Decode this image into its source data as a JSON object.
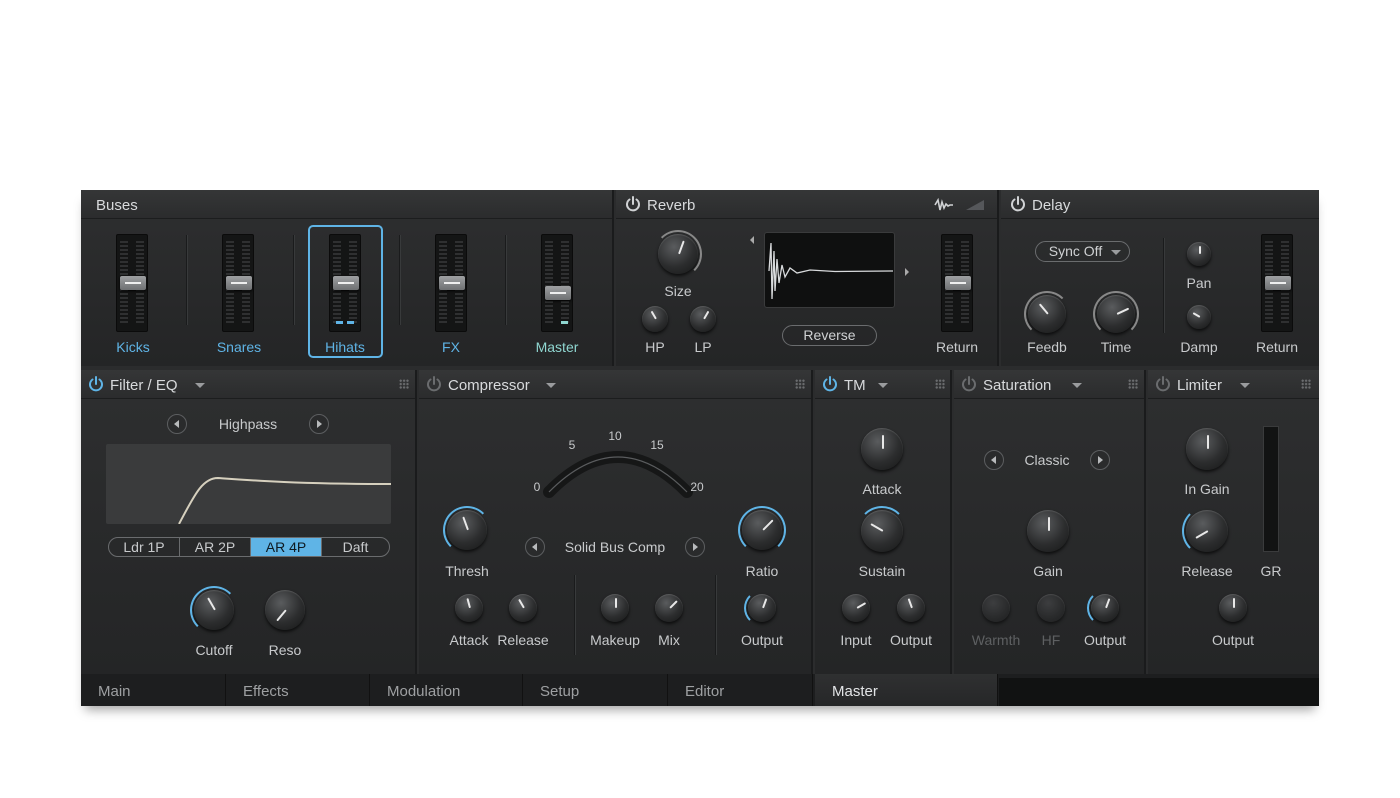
{
  "buses": {
    "title": "Buses",
    "channels": [
      {
        "label": "Kicks",
        "fader_level": 0.5,
        "color": "#5fb4e6"
      },
      {
        "label": "Snares",
        "fader_level": 0.5,
        "color": "#5fb4e6"
      },
      {
        "label": "Hihats",
        "fader_level": 0.5,
        "color": "#5fb4e6",
        "selected": true
      },
      {
        "label": "FX",
        "fader_level": 0.5,
        "color": "#5fb4e6"
      },
      {
        "label": "Master",
        "fader_level": 0.4,
        "color": "#8fd6d0"
      }
    ]
  },
  "reverb": {
    "title": "Reverb",
    "enabled": true,
    "size_label": "Size",
    "hp_label": "HP",
    "lp_label": "LP",
    "reverse_label": "Reverse",
    "return_label": "Return",
    "icons": [
      "waveform-icon",
      "ramp-icon"
    ]
  },
  "delay": {
    "title": "Delay",
    "enabled": true,
    "sync_value": "Sync Off",
    "feedb_label": "Feedb",
    "time_label": "Time",
    "pan_label": "Pan",
    "damp_label": "Damp",
    "return_label": "Return"
  },
  "filter": {
    "title": "Filter / EQ",
    "enabled": true,
    "mode": "Highpass",
    "types": [
      "Ldr 1P",
      "AR 2P",
      "AR 4P",
      "Daft"
    ],
    "selected_type": "AR 4P",
    "cutoff_label": "Cutoff",
    "reso_label": "Reso"
  },
  "compressor": {
    "title": "Compressor",
    "enabled": false,
    "scale": [
      "0",
      "5",
      "10",
      "15",
      "20"
    ],
    "preset": "Solid Bus Comp",
    "thresh_label": "Thresh",
    "ratio_label": "Ratio",
    "attack_label": "Attack",
    "release_label": "Release",
    "makeup_label": "Makeup",
    "mix_label": "Mix",
    "output_label": "Output"
  },
  "tm": {
    "title": "TM",
    "enabled": true,
    "attack_label": "Attack",
    "sustain_label": "Sustain",
    "input_label": "Input",
    "output_label": "Output"
  },
  "saturation": {
    "title": "Saturation",
    "enabled": false,
    "mode": "Classic",
    "gain_label": "Gain",
    "warmth_label": "Warmth",
    "hf_label": "HF",
    "output_label": "Output"
  },
  "limiter": {
    "title": "Limiter",
    "enabled": false,
    "in_gain_label": "In Gain",
    "release_label": "Release",
    "output_label": "Output",
    "gr_label": "GR"
  },
  "tabs": [
    "Main",
    "Effects",
    "Modulation",
    "Setup",
    "Editor",
    "Master"
  ],
  "active_tab": "Master",
  "colors": {
    "accent": "#5fb4e6",
    "panel": "#2b2c2d",
    "text": "#c8cacc"
  }
}
